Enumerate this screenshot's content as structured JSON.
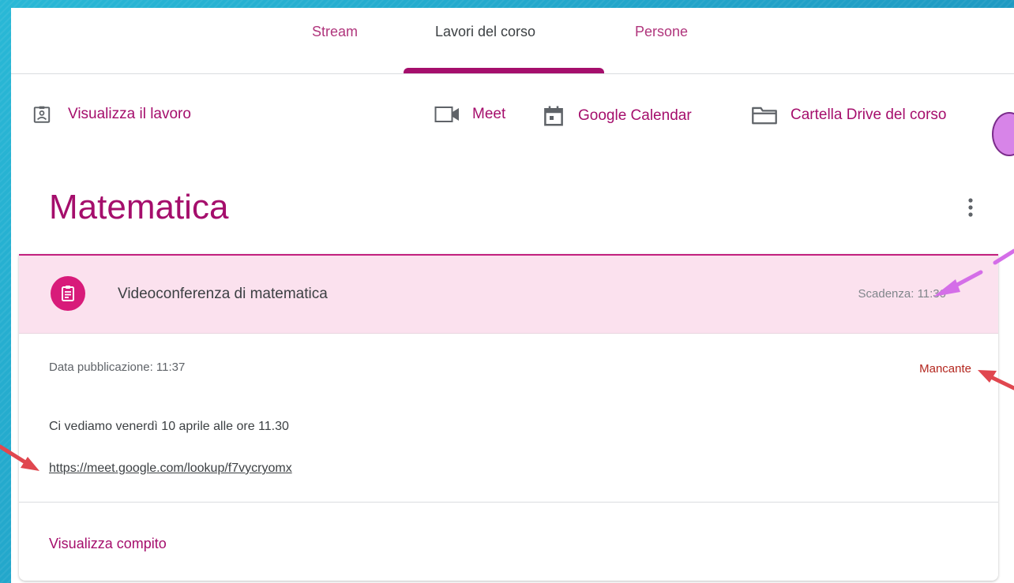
{
  "tabs": [
    {
      "label": "Stream",
      "active": false
    },
    {
      "label": "Lavori del corso",
      "active": true
    },
    {
      "label": "Persone",
      "active": false
    }
  ],
  "toolbar": {
    "view_work": "Visualizza il lavoro",
    "meet": "Meet",
    "calendar": "Google Calendar",
    "drive_folder": "Cartella Drive del corso"
  },
  "topic": {
    "title": "Matematica"
  },
  "assignment": {
    "title": "Videoconferenza di matematica",
    "due": "Scadenza: 11:30",
    "posted": "Data pubblicazione: 11:37",
    "status": "Mancante",
    "description": "Ci vediamo venerdì 10 aprile alle ore 11.30",
    "link": "https://meet.google.com/lookup/f7vycryomx",
    "view_label": "Visualizza compito"
  },
  "colors": {
    "accent": "#a50e6c",
    "assignment_icon_bg": "#d81b7a",
    "header_bg": "#fbe1ee",
    "status_missing": "#b3261e",
    "background_blue": "#1f9cc4",
    "annotation_arrow_red": "#e0474f",
    "annotation_arrow_violet": "#d46ee8"
  }
}
